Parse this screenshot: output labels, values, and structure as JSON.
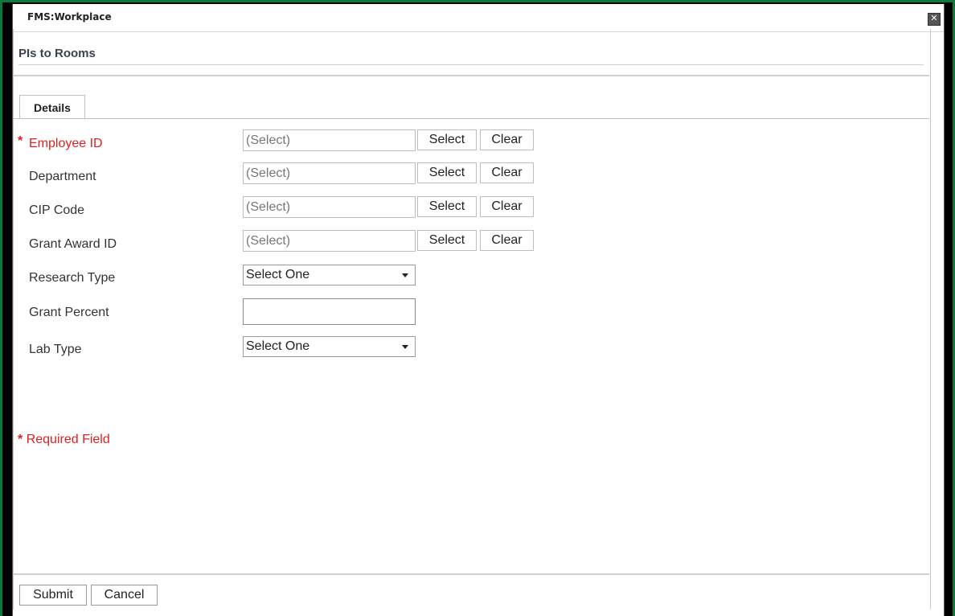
{
  "window": {
    "title": "FMS:Workplace",
    "close_label": "✕"
  },
  "page": {
    "title": "PIs to Rooms"
  },
  "tabs": [
    {
      "label": "Details"
    }
  ],
  "fields": {
    "employee_id": {
      "label": "Employee ID",
      "value": "(Select)",
      "select": "Select",
      "clear": "Clear"
    },
    "department": {
      "label": "Department",
      "value": "(Select)",
      "select": "Select",
      "clear": "Clear"
    },
    "cip_code": {
      "label": "CIP Code",
      "value": "(Select)",
      "select": "Select",
      "clear": "Clear"
    },
    "grant_award_id": {
      "label": "Grant Award ID",
      "value": "(Select)",
      "select": "Select",
      "clear": "Clear"
    },
    "research_type": {
      "label": "Research Type",
      "value": "Select One"
    },
    "grant_percent": {
      "label": "Grant Percent",
      "value": ""
    },
    "lab_type": {
      "label": "Lab Type",
      "value": "Select One"
    }
  },
  "required_marker": "*",
  "required_note": "Required Field",
  "footer": {
    "submit": "Submit",
    "cancel": "Cancel"
  },
  "colors": {
    "frame": "#0b7a3d",
    "required": "#e02020"
  }
}
